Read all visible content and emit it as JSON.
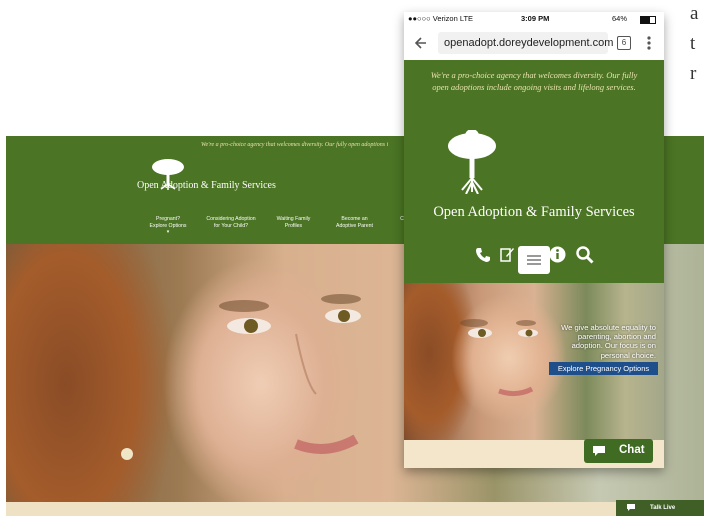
{
  "background_text": [
    "a",
    "t",
    "r"
  ],
  "desktop": {
    "tagline": "We're a pro-choice agency that welcomes diversity. Our fully open adoptions i",
    "logo_text": "Open Adoption & Family Services",
    "nav": [
      {
        "label": "Pregnant? Explore Options ▾"
      },
      {
        "label": "Considering Adoption for Your Child?"
      },
      {
        "label": "Waiting Family Profiles"
      },
      {
        "label": "Become an Adoptive Parent"
      },
      {
        "label": "C"
      }
    ],
    "talk_live": "Talk Live"
  },
  "phone": {
    "status": {
      "carrier": "●●○○○ Verizon  LTE",
      "time": "3:09 PM",
      "battery": "64%"
    },
    "url": "openadopt.doreydevelopment.com",
    "tab_count": "6",
    "tagline": "We're a pro-choice agency that welcomes diversity. Our fully open adoptions include ongoing visits and lifelong services.",
    "logo_text": "Open Adoption & Family Services",
    "hero_text": "We give absolute equality to parenting, abortion and adoption. Our focus is on personal choice.",
    "explore_button": "Explore Pregnancy Options",
    "chat_label": "Chat"
  },
  "colors": {
    "brand_green": "#4b7424",
    "cream": "#f3e6cb",
    "button_blue": "#1f4f8a",
    "chat_green": "#3f6b22"
  },
  "icons": [
    "phone-icon",
    "edit-icon",
    "blog-icon",
    "info-icon",
    "search-icon",
    "hamburger-menu-icon",
    "back-arrow-icon",
    "more-vert-icon",
    "chat-bubble-icon"
  ]
}
